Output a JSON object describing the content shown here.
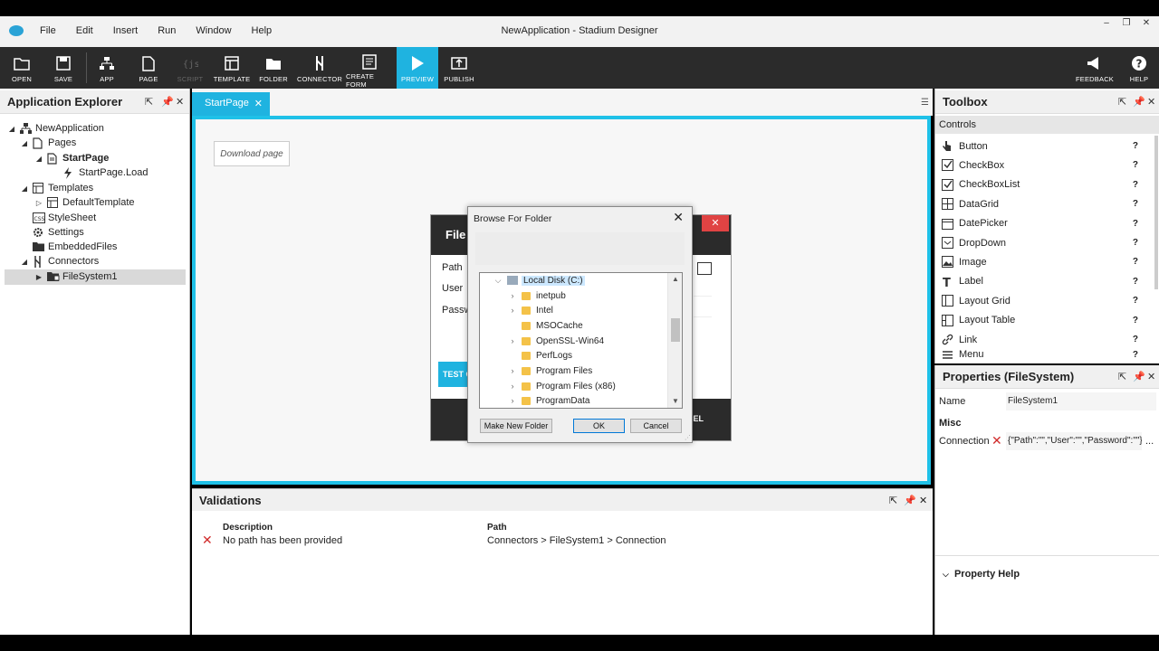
{
  "window": {
    "title": "NewApplication - Stadium Designer",
    "menu": [
      "File",
      "Edit",
      "Insert",
      "Run",
      "Window",
      "Help"
    ],
    "controls": [
      "–",
      "❐",
      "✕"
    ]
  },
  "toolbar": {
    "buttons": [
      {
        "label": "OPEN",
        "icon": "open-folder-icon"
      },
      {
        "label": "SAVE",
        "icon": "save-icon"
      },
      {
        "label": "APP",
        "icon": "app-hierarchy-icon"
      },
      {
        "label": "PAGE",
        "icon": "page-icon"
      },
      {
        "label": "SCRIPT",
        "icon": "script-icon",
        "disabled": true
      },
      {
        "label": "TEMPLATE",
        "icon": "template-icon"
      },
      {
        "label": "FOLDER",
        "icon": "folder-icon"
      },
      {
        "label": "CONNECTOR",
        "icon": "connector-icon"
      },
      {
        "label": "CREATE FORM",
        "icon": "create-form-icon"
      },
      {
        "label": "PREVIEW",
        "icon": "play-icon",
        "active": true
      },
      {
        "label": "PUBLISH",
        "icon": "publish-icon"
      },
      {
        "label": "FEEDBACK",
        "icon": "feedback-icon"
      },
      {
        "label": "HELP",
        "icon": "help-icon"
      }
    ]
  },
  "explorer": {
    "title": "Application Explorer",
    "tree": [
      {
        "label": "NewApplication",
        "icon": "app-hierarchy-icon",
        "expanded": true
      },
      {
        "label": "Pages",
        "icon": "page-icon",
        "expanded": true
      },
      {
        "label": "StartPage",
        "icon": "page-icon",
        "expanded": true,
        "bold": true
      },
      {
        "label": "StartPage.Load",
        "icon": "lightning-icon"
      },
      {
        "label": "Templates",
        "icon": "template-icon",
        "expanded": true
      },
      {
        "label": "DefaultTemplate",
        "icon": "template-icon",
        "expanded": false
      },
      {
        "label": "StyleSheet",
        "icon": "css-icon"
      },
      {
        "label": "Settings",
        "icon": "gear-icon"
      },
      {
        "label": "EmbeddedFiles",
        "icon": "folder-icon"
      },
      {
        "label": "Connectors",
        "icon": "connector-icon",
        "expanded": true
      },
      {
        "label": "FileSystem1",
        "icon": "filesystem-icon",
        "expanded": false,
        "selected": true
      }
    ]
  },
  "editor": {
    "tab": "StartPage",
    "download_button": "Download page"
  },
  "file_dialog": {
    "title": "File",
    "labels": [
      "Path",
      "User",
      "Passwo"
    ],
    "test_button": "TEST C",
    "cancel_button": "CEL"
  },
  "browse": {
    "title": "Browse For Folder",
    "root": "Local Disk (C:)",
    "folders": [
      {
        "name": "inetpub",
        "expandable": true
      },
      {
        "name": "Intel",
        "expandable": true
      },
      {
        "name": "MSOCache",
        "expandable": false
      },
      {
        "name": "OpenSSL-Win64",
        "expandable": true
      },
      {
        "name": "PerfLogs",
        "expandable": false
      },
      {
        "name": "Program Files",
        "expandable": true
      },
      {
        "name": "Program Files (x86)",
        "expandable": true
      },
      {
        "name": "ProgramData",
        "expandable": true
      }
    ],
    "make_new_folder": "Make New Folder",
    "ok": "OK",
    "cancel": "Cancel"
  },
  "toolbox": {
    "title": "Toolbox",
    "section": "Controls",
    "items": [
      {
        "label": "Button",
        "icon": "button-icon"
      },
      {
        "label": "CheckBox",
        "icon": "checkbox-icon"
      },
      {
        "label": "CheckBoxList",
        "icon": "checkboxlist-icon"
      },
      {
        "label": "DataGrid",
        "icon": "datagrid-icon"
      },
      {
        "label": "DatePicker",
        "icon": "datepicker-icon"
      },
      {
        "label": "DropDown",
        "icon": "dropdown-icon"
      },
      {
        "label": "Image",
        "icon": "image-icon"
      },
      {
        "label": "Label",
        "icon": "label-icon"
      },
      {
        "label": "Layout Grid",
        "icon": "layout-grid-icon"
      },
      {
        "label": "Layout Table",
        "icon": "layout-table-icon"
      },
      {
        "label": "Link",
        "icon": "link-icon"
      },
      {
        "label": "Menu",
        "icon": "menu-icon"
      }
    ],
    "help_glyph": "?"
  },
  "properties": {
    "title": "Properties (FileSystem)",
    "name_label": "Name",
    "name_value": "FileSystem1",
    "misc_label": "Misc",
    "connection_label": "Connection",
    "connection_value": "{\"Path\":\"\",\"User\":\"\",\"Password\":\"\"}",
    "ellipsis": "...",
    "property_help": "Property Help"
  },
  "validations": {
    "title": "Validations",
    "columns": [
      "Description",
      "Path"
    ],
    "rows": [
      {
        "description": "No path has been provided",
        "path": "Connectors > FileSystem1 > Connection"
      }
    ]
  },
  "colors": {
    "accent": "#1fb3e0",
    "toolbar_bg": "#2b2b2b",
    "error": "#d12b2b",
    "canvas_border": "#1fc1e8"
  }
}
